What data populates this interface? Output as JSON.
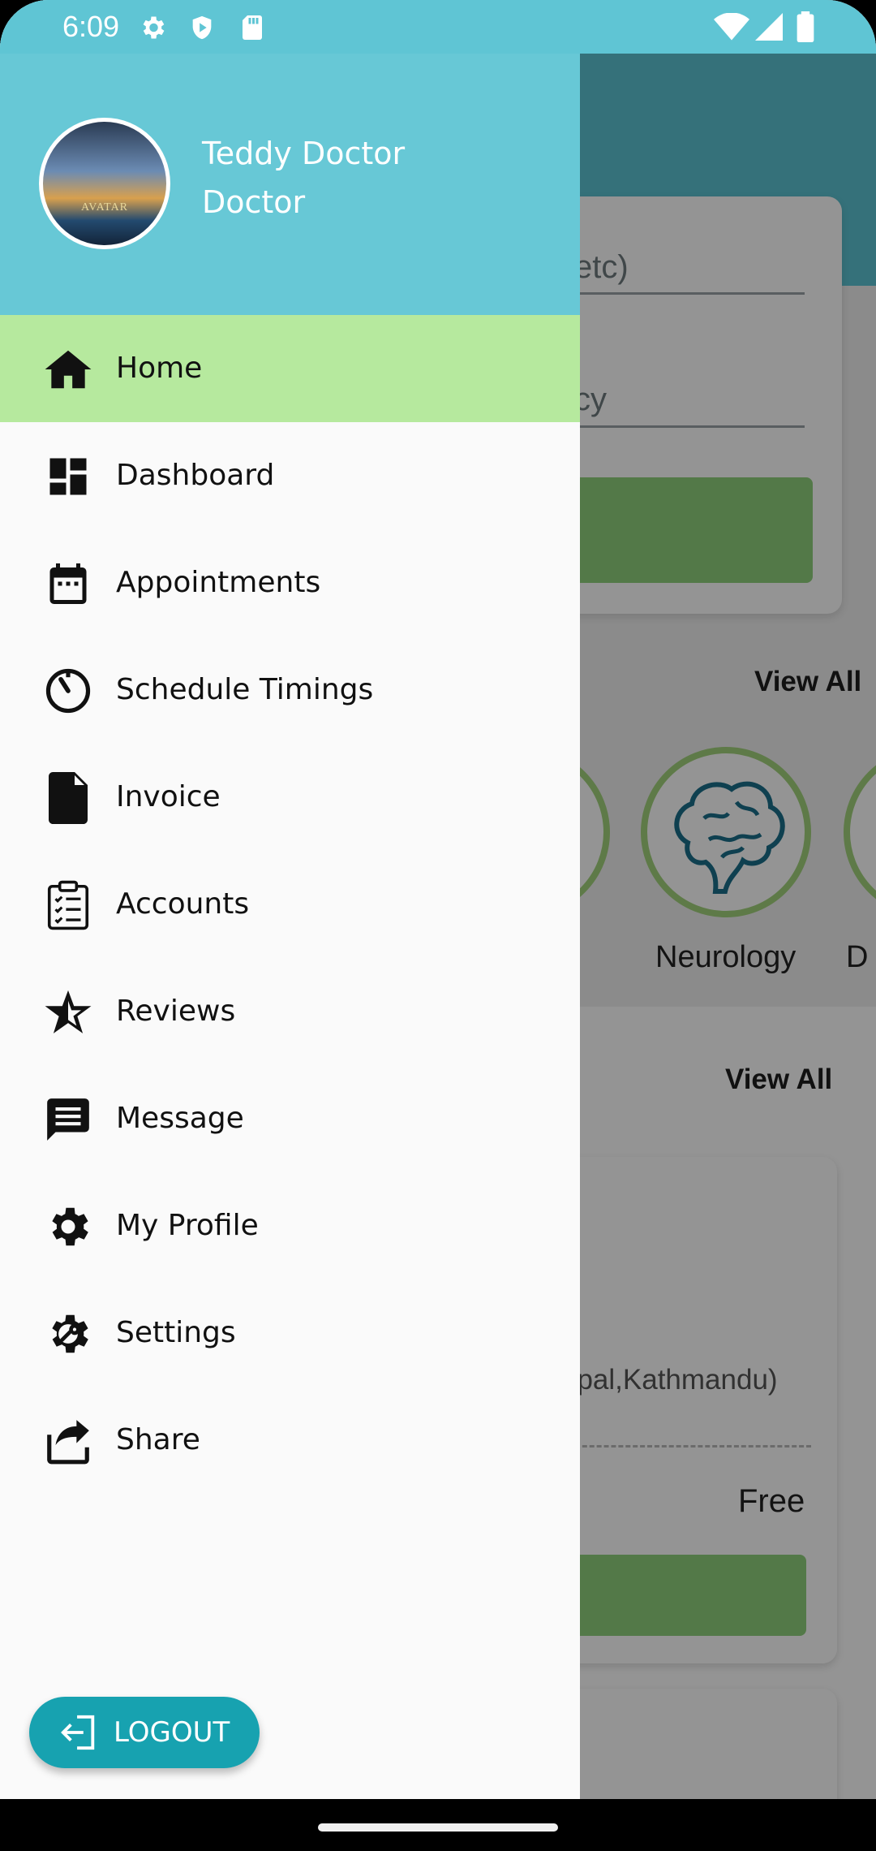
{
  "status_bar": {
    "time": "6:09",
    "icons": [
      "settings-icon",
      "shield-play-icon",
      "sd-card-icon",
      "wifi-icon",
      "signal-icon",
      "battery-icon"
    ]
  },
  "drawer": {
    "user_name": "Teddy Doctor",
    "user_role": "Doctor",
    "avatar_caption": "AVATAR",
    "menu_items": [
      {
        "label": "Home",
        "icon": "home-icon",
        "active": true
      },
      {
        "label": "Dashboard",
        "icon": "dashboard-icon",
        "active": false
      },
      {
        "label": "Appointments",
        "icon": "calendar-icon",
        "active": false
      },
      {
        "label": "Schedule Timings",
        "icon": "timer-icon",
        "active": false
      },
      {
        "label": "Invoice",
        "icon": "document-icon",
        "active": false
      },
      {
        "label": "Accounts",
        "icon": "clipboard-icon",
        "active": false
      },
      {
        "label": "Reviews",
        "icon": "star-icon",
        "active": false
      },
      {
        "label": "Message",
        "icon": "message-icon",
        "active": false
      },
      {
        "label": "My Profile",
        "icon": "gear-icon",
        "active": false
      },
      {
        "label": "Settings",
        "icon": "settings-wrench-icon",
        "active": false
      },
      {
        "label": "Share",
        "icon": "share-icon",
        "active": false
      }
    ],
    "logout_label": "LOGOUT"
  },
  "background": {
    "search_hint_1": "etc)",
    "search_hint_2": "cy",
    "view_all_1": "View All",
    "specialty_label": "Neurology",
    "specialty_label_partial": "D",
    "view_all_2": "View All",
    "doctor_location": "epal,Kathmandu)",
    "doctor_fee": "Free"
  },
  "colors": {
    "header": "#67c8d6",
    "active_item": "#b6e99e",
    "logout": "#17a2b0"
  }
}
